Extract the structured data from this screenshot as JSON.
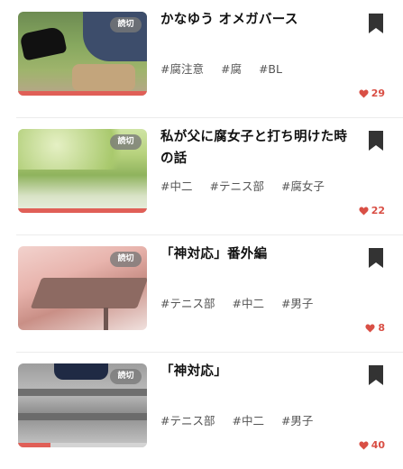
{
  "items": [
    {
      "badge": "読切",
      "title": "かなゆう オメガバース",
      "tags": [
        "#腐注意",
        "#腐",
        "#BL"
      ],
      "likes": "29",
      "progress": 1.0
    },
    {
      "badge": "読切",
      "title": "私が父に腐女子と打ち明けた時の話",
      "tags": [
        "#中二",
        "#テニス部",
        "#腐女子"
      ],
      "likes": "22",
      "progress": 1.0
    },
    {
      "badge": "読切",
      "title": "「神対応」番外編",
      "tags": [
        "#テニス部",
        "#中二",
        "#男子"
      ],
      "likes": "8",
      "progress": 0.0
    },
    {
      "badge": "読切",
      "title": "「神対応」",
      "tags": [
        "#テニス部",
        "#中二",
        "#男子"
      ],
      "likes": "40",
      "progress": 0.25
    }
  ],
  "icons": {
    "bookmark": "bookmark-icon",
    "heart": "heart-icon"
  },
  "colors": {
    "accent": "#e05f57",
    "bookmark": "#333333",
    "heart": "#d94f45"
  }
}
